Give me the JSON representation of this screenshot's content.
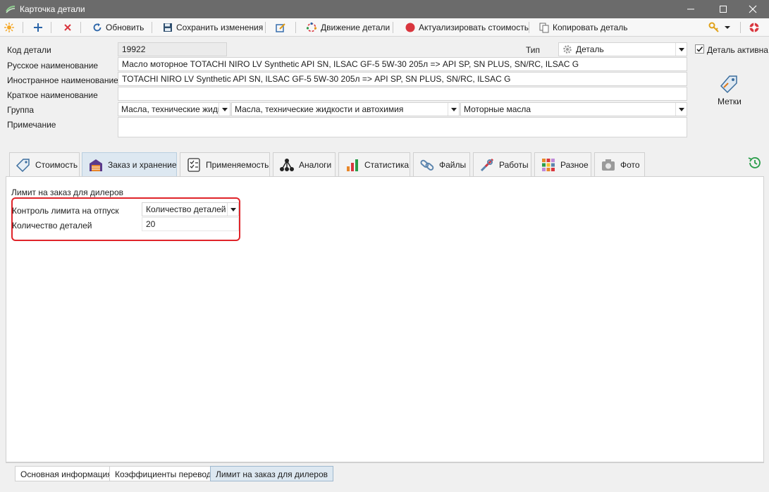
{
  "window": {
    "title": "Карточка детали"
  },
  "toolbar": {
    "refresh_label": "Обновить",
    "save_label": "Сохранить изменения",
    "movement_label": "Движение детали",
    "update_cost_label": "Актуализировать стоимость",
    "copy_label": "Копировать деталь"
  },
  "form": {
    "code_label": "Код детали",
    "code_value": "19922",
    "type_label": "Тип",
    "type_value": "Деталь",
    "active_label": "Деталь активна",
    "active_checked": true,
    "ru_name_label": "Русское наименование",
    "ru_name_value": "Масло моторное TOTACHI NIRO LV Synthetic API SN, ILSAC GF-5 5W-30 205л => API SP, SN PLUS, SN/RC, ILSAC G",
    "foreign_name_label": "Иностранное наименование",
    "foreign_name_value": "TOTACHI NIRO LV Synthetic API SN, ILSAC GF-5 5W-30 205л => API SP, SN PLUS, SN/RC, ILSAC G",
    "short_name_label": "Краткое наименование",
    "short_name_value": "",
    "group_label": "Группа",
    "group1_value": "Масла, технические жидко",
    "group2_value": "Масла, технические жидкости и автохимия",
    "group3_value": "Моторные масла",
    "note_label": "Примечание",
    "note_value": "",
    "tags_label": "Метки"
  },
  "tabs": [
    {
      "label": "Стоимость",
      "icon": "price-tag-icon"
    },
    {
      "label": "Заказ и хранение",
      "icon": "warehouse-icon"
    },
    {
      "label": "Применяемость",
      "icon": "checklist-icon"
    },
    {
      "label": "Аналоги",
      "icon": "hierarchy-icon"
    },
    {
      "label": "Статистика",
      "icon": "bar-chart-icon"
    },
    {
      "label": "Файлы",
      "icon": "link-icon"
    },
    {
      "label": "Работы",
      "icon": "tools-icon"
    },
    {
      "label": "Разное",
      "icon": "grid-icon"
    },
    {
      "label": "Фото",
      "icon": "camera-icon"
    }
  ],
  "active_tab": "Заказ и хранение",
  "dealer_limit": {
    "section_title": "Лимит на заказ для дилеров",
    "control_label": "Контроль лимита на отпуск",
    "control_value": "Количество деталей",
    "qty_label": "Количество деталей",
    "qty_value": "20"
  },
  "bottom_tabs": [
    {
      "label": "Основная информация"
    },
    {
      "label": "Коэффициенты перевода"
    },
    {
      "label": "Лимит на заказ для дилеров"
    }
  ],
  "active_bottom_tab": "Лимит на заказ для дилеров",
  "colors": {
    "titlebar": "#6b6b6b",
    "active_tab": "#dde8f1",
    "highlight_box": "#e0242a"
  }
}
